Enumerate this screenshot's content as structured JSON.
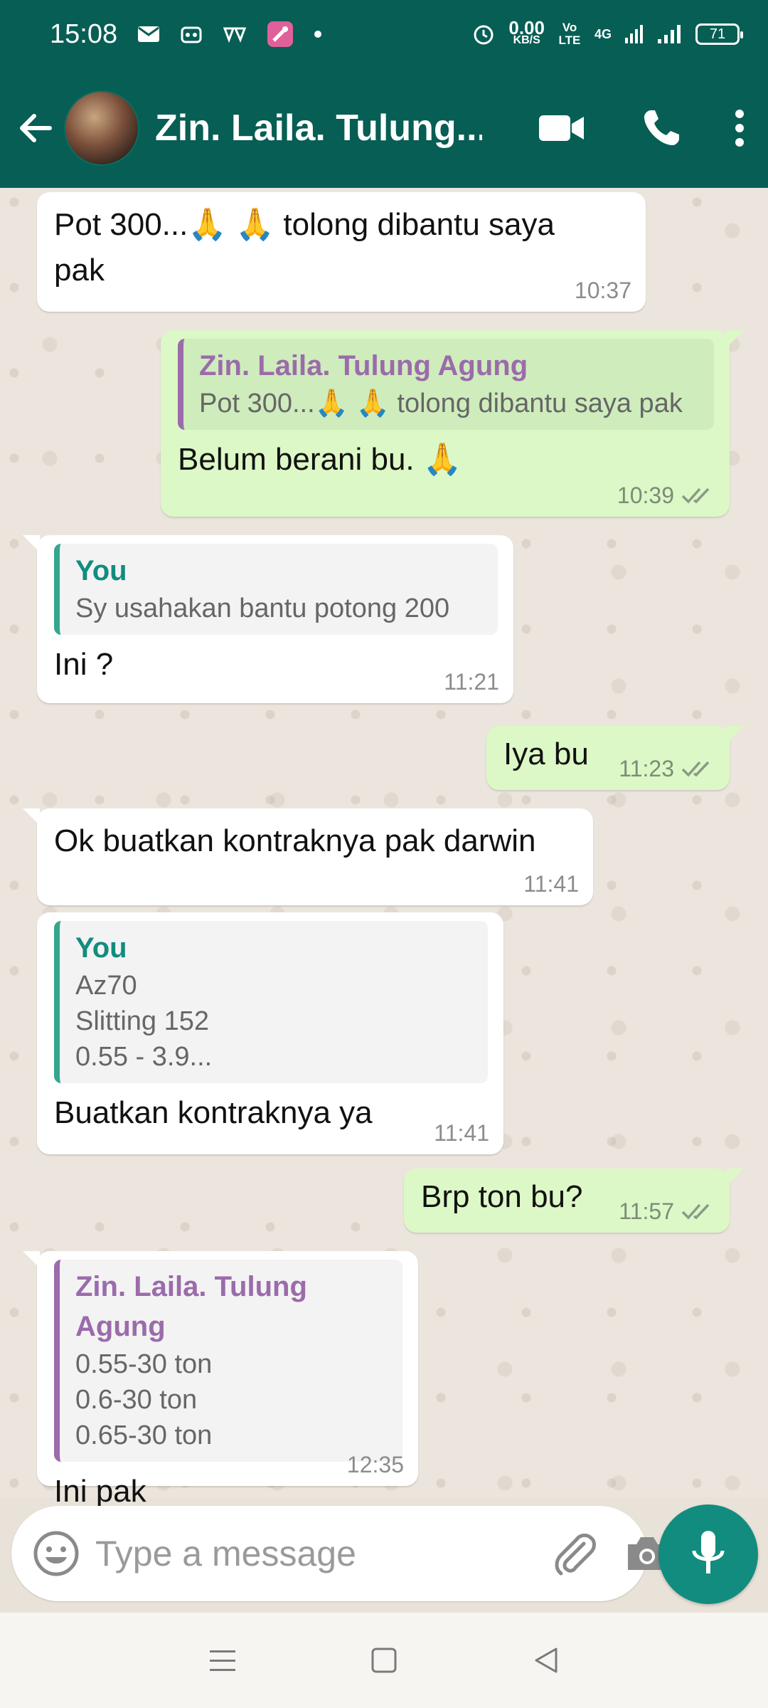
{
  "status_bar": {
    "time": "15:08",
    "net_speed_value": "0.00",
    "net_speed_unit": "KB/S",
    "volte": "Vo LTE",
    "network": "4G",
    "battery": "71"
  },
  "header": {
    "contact_name": "Zin. Laila. Tulung...",
    "icons": [
      "back-arrow-icon",
      "video-call-icon",
      "phone-call-icon",
      "more-options-icon"
    ]
  },
  "messages": [
    {
      "direction": "in",
      "text_line1": "Pot 300...🙏 🙏 tolong dibantu saya",
      "text_line2": "pak",
      "time": "10:37"
    },
    {
      "direction": "out",
      "quote_author": "Zin. Laila. Tulung Agung",
      "quote_text": "Pot 300...🙏 🙏 tolong dibantu saya pak",
      "text": "Belum berani bu. 🙏",
      "time": "10:39",
      "status": "read"
    },
    {
      "direction": "in",
      "quote_author": "You",
      "quote_text": "Sy usahakan  bantu potong 200",
      "text": "Ini ?",
      "time": "11:21"
    },
    {
      "direction": "out",
      "text": "Iya bu",
      "time": "11:23",
      "status": "read"
    },
    {
      "direction": "in",
      "text": "Ok buatkan kontraknya pak darwin",
      "time": "11:41"
    },
    {
      "direction": "in",
      "quote_author": "You",
      "quote_text": "Az70\nSlitting 152\n0.55 - 3.9...",
      "text": "Buatkan kontraknya ya",
      "time": "11:41"
    },
    {
      "direction": "out",
      "text": "Brp ton bu?",
      "time": "11:57",
      "status": "read"
    },
    {
      "direction": "in",
      "quote_author": "Zin. Laila. Tulung Agung",
      "quote_text": "0.55-30 ton\n0.6-30 ton\n0.65-30 ton",
      "text": "Ini pak",
      "time": "12:35"
    }
  ],
  "composer": {
    "placeholder": "Type a message",
    "icons": [
      "emoji-icon",
      "attach-icon",
      "camera-icon",
      "mic-icon"
    ]
  },
  "colors": {
    "header": "#075e54",
    "outgoing_bubble": "#dcf8c6",
    "incoming_bubble": "#ffffff",
    "accent": "#128c7e",
    "quote_purple": "#9b6bab",
    "read_ticks": "#8a9a87"
  }
}
